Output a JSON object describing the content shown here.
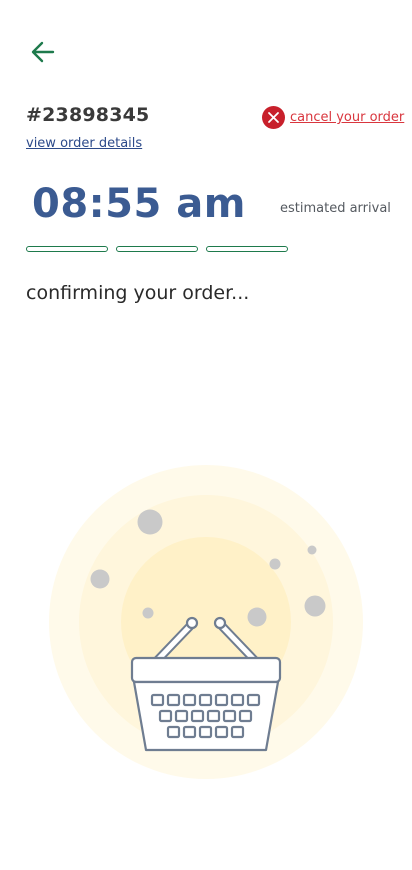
{
  "header": {
    "back_icon": "arrow-left-icon"
  },
  "order": {
    "number": "#23898345",
    "view_details_label": "view order details",
    "cancel_label": "cancel your order",
    "cancel_icon": "close-circle-icon"
  },
  "eta": {
    "time": "08:55 am",
    "label": "estimated arrival"
  },
  "progress": {
    "steps_total": 3,
    "steps_completed": 0
  },
  "status": {
    "message": "confirming your order..."
  },
  "illustration": {
    "icon": "shopping-basket-icon"
  },
  "colors": {
    "accent_green": "#1e7a4c",
    "link_blue": "#2c4a8a",
    "eta_blue": "#3b5b92",
    "cancel_red": "#c8202b",
    "glow_outer": "#fffaea",
    "glow_mid": "#fff6dc",
    "glow_inner": "#fff1c8",
    "basket_stroke": "#6f7d91"
  }
}
